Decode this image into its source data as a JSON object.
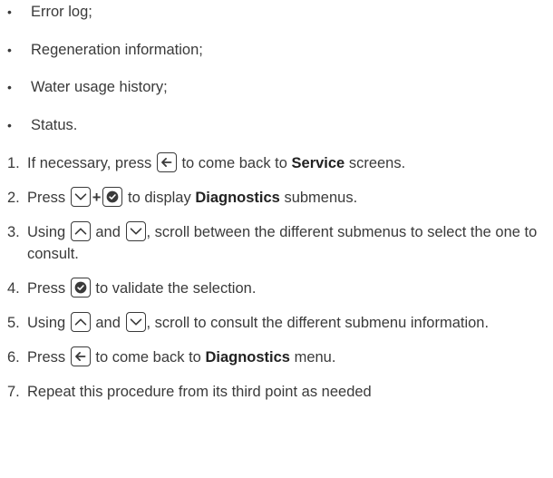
{
  "bullets": [
    "Error log;",
    "Regeneration information;",
    "Water usage history;",
    "Status."
  ],
  "steps": [
    {
      "num": "1.",
      "pre": "If necessary, press",
      "post": "to come back to",
      "bold": "Service",
      "tail": "screens."
    },
    {
      "num": "2.",
      "pre": "Press",
      "post": "to display",
      "bold": "Diagnostics",
      "tail": "submenus."
    },
    {
      "num": "3.",
      "pre": "Using",
      "mid": "and",
      "post": ", scroll between the different submenus to select the one to consult."
    },
    {
      "num": "4.",
      "pre": "Press",
      "post": "to validate the selection."
    },
    {
      "num": "5.",
      "pre": "Using",
      "mid": "and",
      "post": ", scroll to consult the different submenu information."
    },
    {
      "num": "6.",
      "pre": "Press",
      "post": "to come back to",
      "bold": "Diagnostics",
      "tail": "menu."
    },
    {
      "num": "7.",
      "pre": "Repeat this procedure from its third point as needed"
    }
  ],
  "icons": {
    "back": "back-arrow-key",
    "down": "down-chevron-key",
    "up": "up-chevron-key",
    "check": "check-key"
  },
  "plus_sign": "+"
}
